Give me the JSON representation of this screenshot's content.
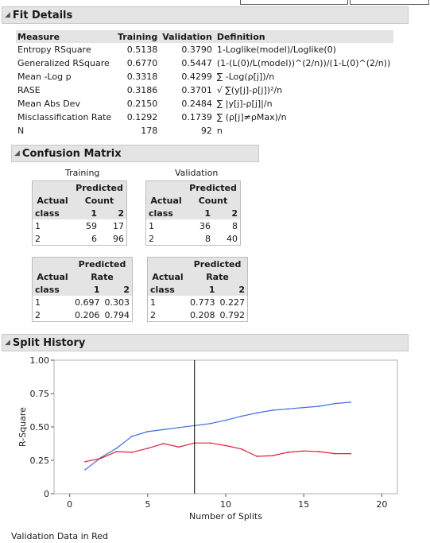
{
  "fit_details": {
    "title": "Fit Details",
    "columns": [
      "Measure",
      "Training",
      "Validation",
      "Definition"
    ],
    "rows": [
      [
        "Entropy RSquare",
        "0.5138",
        "0.3790",
        "1-Loglike(model)/Loglike(0)"
      ],
      [
        "Generalized RSquare",
        "0.6770",
        "0.5447",
        "(1-(L(0)/L(model))^(2/n))/(1-L(0)^(2/n))"
      ],
      [
        "Mean -Log p",
        "0.3318",
        "0.4299",
        "∑ -Log(ρ[j])/n"
      ],
      [
        "RASE",
        "0.3186",
        "0.3701",
        "√ ∑(y[j]-ρ[j])²/n"
      ],
      [
        "Mean Abs Dev",
        "0.2150",
        "0.2484",
        "∑ |y[j]-ρ[j]|/n"
      ],
      [
        "Misclassification Rate",
        "0.1292",
        "0.1739",
        "∑ (ρ[j]≠ρMax)/n"
      ],
      [
        "N",
        "178",
        "92",
        "n"
      ]
    ]
  },
  "confusion_matrix": {
    "title": "Confusion Matrix",
    "training_label": "Training",
    "validation_label": "Validation",
    "predicted_label": "Predicted",
    "count_label": "Count",
    "rate_label": "Rate",
    "actual_label": "Actual",
    "class_label": "class",
    "pred_classes": [
      "1",
      "2"
    ],
    "training_count": [
      [
        "1",
        "59",
        "17"
      ],
      [
        "2",
        "6",
        "96"
      ]
    ],
    "validation_count": [
      [
        "1",
        "36",
        "8"
      ],
      [
        "2",
        "8",
        "40"
      ]
    ],
    "training_rate": [
      [
        "1",
        "0.697",
        "0.303"
      ],
      [
        "2",
        "0.206",
        "0.794"
      ]
    ],
    "validation_rate": [
      [
        "1",
        "0.773",
        "0.227"
      ],
      [
        "2",
        "0.208",
        "0.792"
      ]
    ]
  },
  "split_history": {
    "title": "Split History",
    "footnote": "Validation Data in Red"
  },
  "chart_data": {
    "type": "line",
    "xlabel": "Number of Splits",
    "ylabel": "R-Square",
    "xlim": [
      -1,
      21
    ],
    "ylim": [
      0,
      1
    ],
    "x_ticks": [
      0,
      5,
      10,
      15,
      20
    ],
    "y_ticks": [
      "0",
      "0.25",
      "0.50",
      "0.75",
      "1.00"
    ],
    "y_tick_values": [
      0,
      0.25,
      0.5,
      0.75,
      1.0
    ],
    "grid": false,
    "reference_line_x": 8,
    "series": [
      {
        "color": "#3c6fe0",
        "x": [
          1,
          2,
          3,
          4,
          5,
          6,
          7,
          8,
          9,
          10,
          11,
          12,
          13,
          14,
          15,
          16,
          17,
          18
        ],
        "values": [
          0.18,
          0.27,
          0.34,
          0.43,
          0.465,
          0.48,
          0.495,
          0.51,
          0.525,
          0.55,
          0.58,
          0.605,
          0.625,
          0.635,
          0.645,
          0.655,
          0.675,
          0.685
        ]
      },
      {
        "color": "#e0203c",
        "x": [
          1,
          2,
          3,
          4,
          5,
          6,
          7,
          8,
          9,
          10,
          11,
          12,
          13,
          14,
          15,
          16,
          17,
          18
        ],
        "values": [
          0.24,
          0.265,
          0.315,
          0.31,
          0.34,
          0.375,
          0.35,
          0.38,
          0.38,
          0.36,
          0.335,
          0.28,
          0.285,
          0.31,
          0.32,
          0.315,
          0.3,
          0.3
        ]
      }
    ]
  }
}
